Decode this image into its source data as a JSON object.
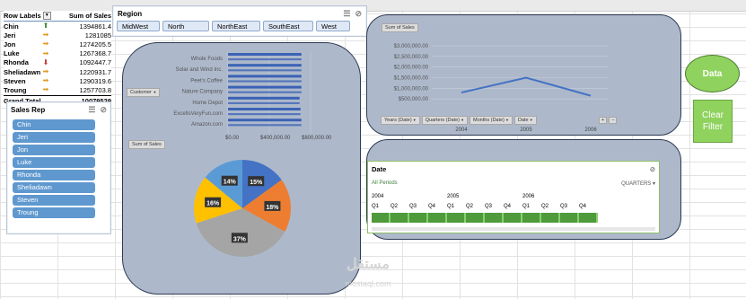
{
  "pivot": {
    "col_row_label": "Row Labels",
    "col_sum": "Sum of Sales",
    "rows": [
      {
        "name": "Chin",
        "icon": "up-arrow-icon",
        "value": "1394861.4"
      },
      {
        "name": "Jeri",
        "icon": "right-arrow-icon",
        "value": "1281085"
      },
      {
        "name": "Jon",
        "icon": "right-arrow-icon",
        "value": "1274205.5"
      },
      {
        "name": "Luke",
        "icon": "right-arrow-icon",
        "value": "1267368.7"
      },
      {
        "name": "Rhonda",
        "icon": "down-arrow-icon",
        "value": "1092447.7"
      },
      {
        "name": "Sheliadawn",
        "icon": "right-arrow-icon",
        "value": "1220931.7"
      },
      {
        "name": "Steven",
        "icon": "right-arrow-icon",
        "value": "1290319.6"
      },
      {
        "name": "Troung",
        "icon": "right-arrow-icon",
        "value": "1257703.8"
      }
    ],
    "total_label": "Grand Total",
    "total_value": "10079529"
  },
  "sales_rep_slicer": {
    "title": "Sales Rep",
    "items": [
      "Chin",
      "Jeri",
      "Jon",
      "Luke",
      "Rhonda",
      "Sheliadawn",
      "Steven",
      "Troung"
    ]
  },
  "region_slicer": {
    "title": "Region",
    "items": [
      "MidWest",
      "North",
      "NorthEast",
      "SouthEast",
      "West"
    ]
  },
  "bar_panel": {
    "field_button": "Customer",
    "value_button": "Sum of Sales"
  },
  "line_panel": {
    "value_button": "Sum of Sales",
    "field_buttons": [
      "Years (Date)",
      "Quarters (Date)",
      "Months (Date)",
      "Date"
    ]
  },
  "timeline": {
    "title": "Date",
    "all_periods": "All Periods",
    "level": "QUARTERS",
    "years": [
      {
        "label": "2004",
        "slot": 0
      },
      {
        "label": "2005",
        "slot": 4
      },
      {
        "label": "2006",
        "slot": 8
      }
    ],
    "quarters": [
      "Q1",
      "Q2",
      "Q3",
      "Q4",
      "Q1",
      "Q2",
      "Q3",
      "Q4",
      "Q1",
      "Q2",
      "Q3",
      "Q4"
    ]
  },
  "buttons": {
    "data": "Data",
    "clear_filter": "Clear Filter"
  },
  "watermark": {
    "arabic": "مستقل",
    "latin": "mostaql.com"
  },
  "colors": {
    "panel": "#adb9cb",
    "bar": "#3b62b5",
    "line": "#4472c4",
    "button": "#8fd35e",
    "slicer_item": "#5f98cf"
  },
  "chart_data": [
    {
      "type": "bar",
      "orientation": "horizontal",
      "categories": [
        "Whole Foods",
        "Solar and Wind Inc.",
        "Peet's Coffee",
        "Nature Company",
        "Home Depot",
        "ExcelIsVeryFun.com",
        "Amazon.com"
      ],
      "values": [
        800000,
        800000,
        800000,
        800000,
        780000,
        790000,
        800000
      ],
      "xticks": [
        "$0.00",
        "$400,000.00",
        "$800,000.00"
      ],
      "xlim": [
        0,
        900000
      ]
    },
    {
      "type": "line",
      "x": [
        "2004",
        "2005",
        "2006"
      ],
      "values": [
        800000,
        1500000,
        650000
      ],
      "yticks": [
        "$500,000.00",
        "$1,000,000.00",
        "$1,500,000.00",
        "$2,000,000.00",
        "$2,500,000.00",
        "$3,000,000.00"
      ],
      "ylim": [
        0,
        3000000
      ]
    },
    {
      "type": "pie",
      "labels": [
        "14%",
        "15%",
        "18%",
        "37%",
        "16%"
      ],
      "values": [
        14,
        15,
        18,
        37,
        16
      ],
      "colors": [
        "#5b9bd5",
        "#4472c4",
        "#ed7d31",
        "#a5a5a5",
        "#ffc000"
      ]
    }
  ]
}
